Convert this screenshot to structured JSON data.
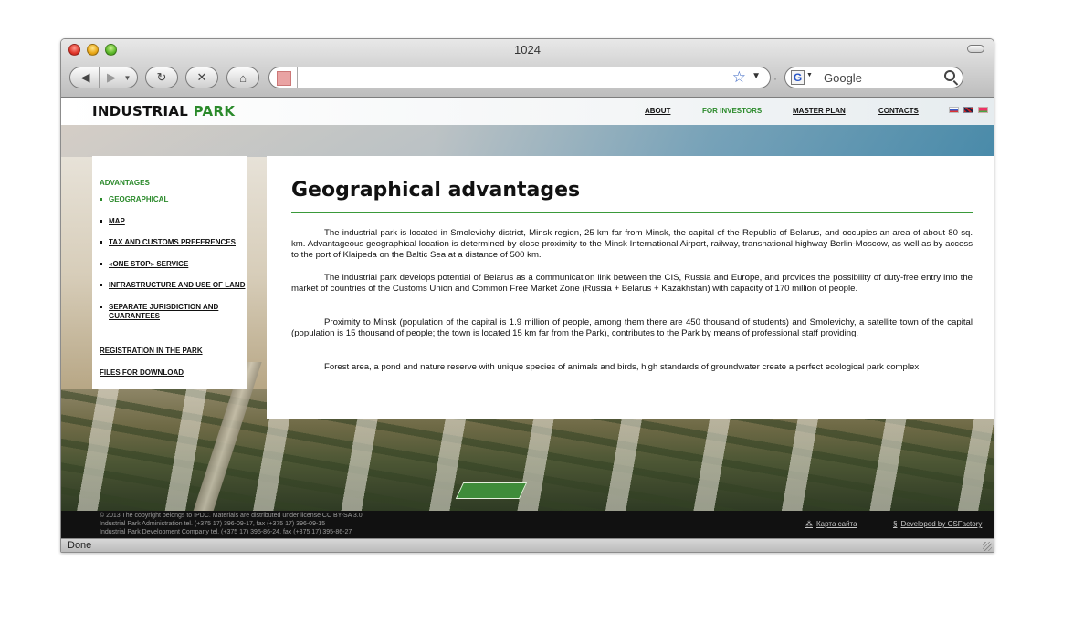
{
  "browser": {
    "window_title": "1024",
    "search_placeholder": "Google",
    "status": "Done"
  },
  "site": {
    "logo_part1": "INDUSTRIAL",
    "logo_part2": "PARK",
    "nav": [
      {
        "label": "ABOUT"
      },
      {
        "label": "FOR INVESTORS"
      },
      {
        "label": "MASTER PLAN"
      },
      {
        "label": "CONTACTS"
      }
    ]
  },
  "sidebar": {
    "heading": "ADVANTAGES",
    "items": [
      {
        "label": "GEOGRAPHICAL"
      },
      {
        "label": "MAP"
      },
      {
        "label": "TAX AND CUSTOMS PREFERENCES"
      },
      {
        "label": "«ONE STOP» SERVICE"
      },
      {
        "label": "INFRASTRUCTURE AND USE OF LAND"
      },
      {
        "label": "SEPARATE JURISDICTION AND GUARANTEES"
      }
    ],
    "links": [
      {
        "label": "REGISTRATION IN THE PARK"
      },
      {
        "label": "FILES FOR DOWNLOAD"
      }
    ]
  },
  "content": {
    "title": "Geographical advantages",
    "paragraphs": [
      "The industrial park is located in Smolevichy district, Minsk region, 25 km far from Minsk, the capital of the Republic of Belarus, and occupies an area of about 80 sq. km. Advantageous geographical location is determined by close proximity to the Minsk International Airport, railway, transnational highway Berlin-Moscow, as well as by access to the port of Klaipeda on the Baltic Sea at a distance of 500 km.",
      "The industrial park develops potential of Belarus as a communication link between the CIS, Russia and Europe, and provides the possibility of duty-free entry into the market of countries of the Customs Union and Common Free Market Zone (Russia + Belarus + Kazakhstan) with capacity of 170 million of people.",
      "Proximity to Minsk (population of the capital is 1.9 million of people, among them there are 450 thousand of students) and Smolevichy, a satellite town of the capital (population is 15 thousand of people; the town is located 15 km far from the Park), contributes to the Park by means of professional staff providing.",
      "Forest area, a pond and nature reserve with unique species of animals and birds, high standards of groundwater create a perfect ecological park complex."
    ]
  },
  "footer": {
    "lines": [
      "© 2013  The copyright belongs to IPDC. Materials are distributed under license CC BY-SA 3.0",
      "Industrial Park Administration tel. (+375 17) 396-09-17, fax (+375 17) 396-09-15",
      "Industrial Park Development Company tel. (+375 17) 395-86-24, fax (+375 17) 395-86-27"
    ],
    "sitemap": "Карта сайта",
    "developer": "Developed by CSFactory"
  }
}
